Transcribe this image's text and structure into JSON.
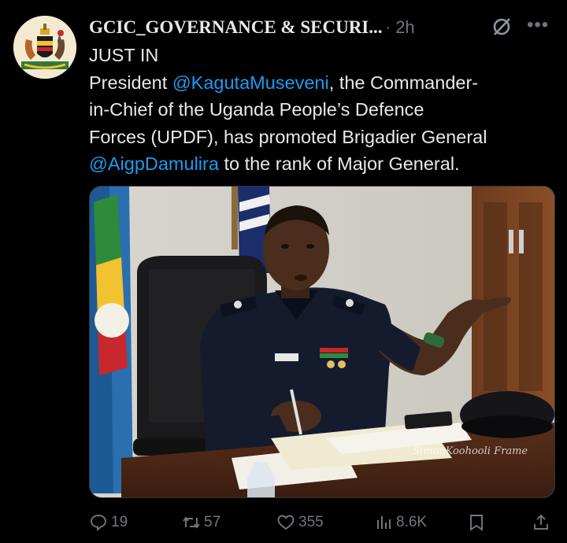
{
  "tweet": {
    "author": "GCIC_GOVERNANCE & SECURI...",
    "separator": "·",
    "time": "2h",
    "line1": "JUST IN",
    "line2a": "President ",
    "mention1": "@KagutaMuseveni",
    "line2b": ", the Commander-",
    "line3": "in-Chief of the Uganda People’s Defence",
    "line4": "Forces (UPDF), has promoted Brigadier General",
    "mention2": "@AigpDamulira",
    "line5b": " to the rank of Major General."
  },
  "media": {
    "watermark": "SimonKoohooli Frame"
  },
  "actions": {
    "replies": "19",
    "reposts": "57",
    "likes": "355",
    "views": "8.6K"
  },
  "icons": [
    "coat-of-arms-avatar",
    "grok-icon",
    "more-icon",
    "reply-icon",
    "repost-icon",
    "like-icon",
    "views-icon",
    "bookmark-icon",
    "share-icon"
  ],
  "colors": {
    "background": "#000000",
    "text": "#e7e9ea",
    "secondary": "#71767b",
    "link": "#1d9bf0"
  }
}
